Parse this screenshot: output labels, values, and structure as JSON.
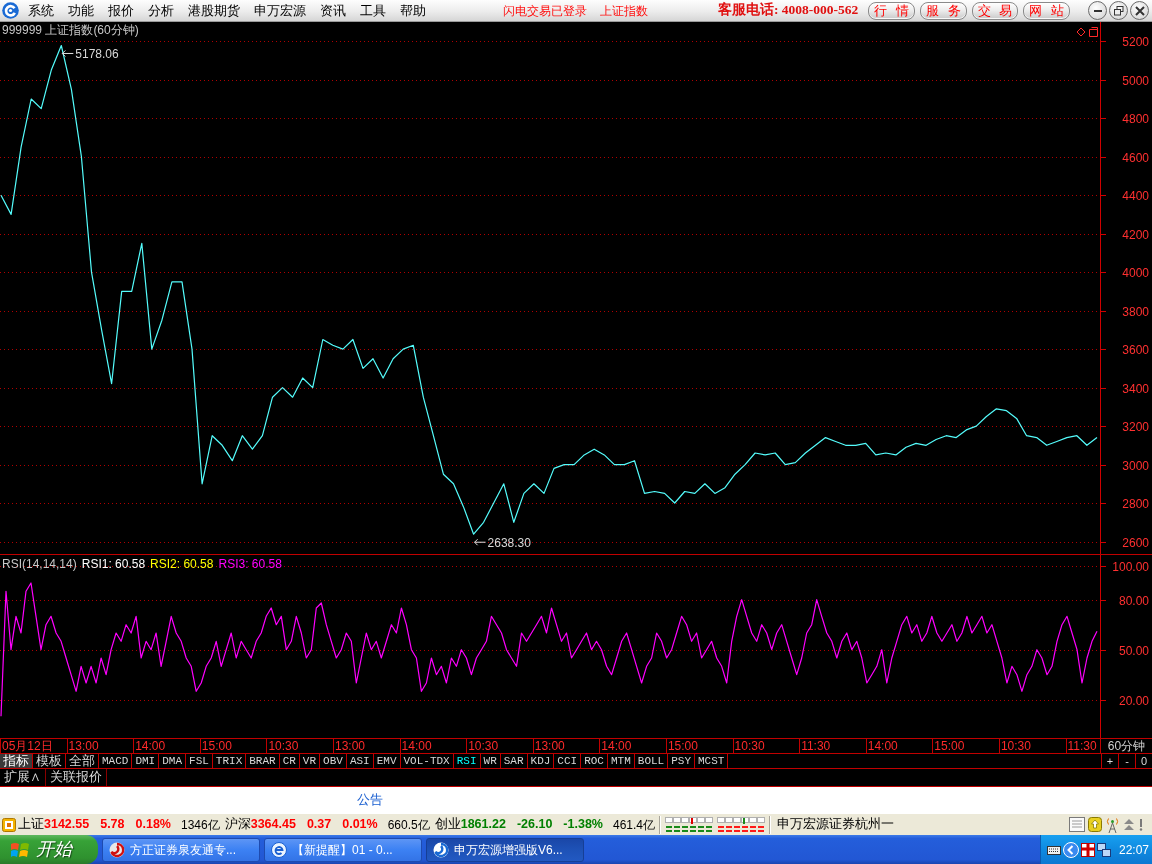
{
  "menu_bar": {
    "menus": [
      "系统",
      "功能",
      "报价",
      "分析",
      "港股期货",
      "申万宏源",
      "资讯",
      "工具",
      "帮助"
    ],
    "notices": [
      "闪电交易已登录",
      "上证指数"
    ],
    "hotline": "客服电话: 4008-000-562",
    "buttons": [
      "行 情",
      "服 务",
      "交 易",
      "网 站"
    ]
  },
  "price_panel": {
    "chart_data": {
      "type": "line",
      "title": "999999 上证指数(60分钟)",
      "grid": true,
      "ylim": [
        2530,
        5300
      ],
      "yticks": [
        2600,
        2800,
        3000,
        3200,
        3400,
        3600,
        3800,
        4000,
        4200,
        4400,
        4600,
        4800,
        5000,
        5200
      ],
      "series": [
        {
          "color": "#54fcfc",
          "values": [
            4400,
            4300,
            4650,
            4900,
            4850,
            5050,
            5178,
            4950,
            4600,
            4000,
            3700,
            3420,
            3900,
            3900,
            4150,
            3600,
            3750,
            3950,
            3950,
            3600,
            2900,
            3150,
            3100,
            3020,
            3150,
            3080,
            3150,
            3350,
            3400,
            3350,
            3450,
            3400,
            3650,
            3620,
            3600,
            3650,
            3500,
            3550,
            3450,
            3550,
            3600,
            3620,
            3350,
            3150,
            2950,
            2900,
            2780,
            2638,
            2700,
            2800,
            2900,
            2700,
            2850,
            2900,
            2850,
            2980,
            3000,
            3000,
            3050,
            3080,
            3050,
            3000,
            3000,
            3020,
            2850,
            2860,
            2850,
            2800,
            2860,
            2850,
            2900,
            2850,
            2880,
            2950,
            3000,
            3060,
            3050,
            3060,
            3000,
            3010,
            3060,
            3100,
            3140,
            3120,
            3100,
            3100,
            3110,
            3050,
            3060,
            3050,
            3090,
            3110,
            3100,
            3130,
            3150,
            3140,
            3180,
            3200,
            3250,
            3290,
            3280,
            3240,
            3150,
            3140,
            3100,
            3120,
            3140,
            3150,
            3100,
            3140
          ]
        }
      ],
      "annotations": [
        "5178.06",
        "2638.30"
      ]
    }
  },
  "rsi_panel": {
    "legend": [
      {
        "label": "RSI1: 60.58",
        "color": "#ffffff"
      },
      {
        "label": "RSI2: 60.58",
        "color": "#ffff00"
      },
      {
        "label": "RSI3: 60.58",
        "color": "#ff00ff"
      }
    ],
    "chart_data": {
      "type": "line",
      "title": "RSI(14,14,14)",
      "grid": true,
      "ylim": [
        -3,
        106.8
      ],
      "yticks": [
        {
          "value": 20,
          "label": "20.00"
        },
        {
          "value": 50,
          "label": "50.00"
        },
        {
          "value": 80,
          "label": "80.00"
        },
        {
          "value": 100,
          "label": "100.00"
        }
      ],
      "series": [
        {
          "color": "#ff00ff",
          "values": [
            10,
            85,
            50,
            70,
            60,
            85,
            90,
            70,
            50,
            65,
            70,
            60,
            55,
            45,
            35,
            25,
            40,
            30,
            40,
            30,
            45,
            35,
            50,
            60,
            55,
            65,
            60,
            70,
            45,
            55,
            50,
            60,
            40,
            55,
            70,
            60,
            55,
            45,
            40,
            25,
            30,
            40,
            45,
            55,
            40,
            50,
            60,
            45,
            55,
            50,
            45,
            55,
            60,
            70,
            75,
            65,
            70,
            50,
            55,
            70,
            60,
            45,
            50,
            75,
            78,
            65,
            55,
            45,
            50,
            60,
            55,
            30,
            45,
            60,
            50,
            55,
            45,
            55,
            65,
            60,
            75,
            65,
            50,
            45,
            25,
            30,
            45,
            35,
            40,
            30,
            45,
            40,
            50,
            45,
            35,
            45,
            50,
            55,
            70,
            65,
            60,
            50,
            45,
            40,
            60,
            55,
            60,
            65,
            70,
            60,
            75,
            65,
            55,
            60,
            45,
            50,
            55,
            60,
            50,
            55,
            50,
            40,
            35,
            45,
            55,
            60,
            50,
            40,
            30,
            40,
            45,
            60,
            55,
            45,
            50,
            60,
            70,
            65,
            55,
            60,
            45,
            50,
            55,
            45,
            40,
            30,
            55,
            70,
            80,
            70,
            60,
            55,
            65,
            60,
            50,
            60,
            65,
            55,
            45,
            35,
            45,
            60,
            65,
            80,
            70,
            60,
            55,
            45,
            55,
            60,
            50,
            55,
            45,
            30,
            35,
            40,
            50,
            30,
            45,
            55,
            65,
            70,
            60,
            65,
            55,
            60,
            70,
            60,
            55,
            60,
            65,
            55,
            60,
            70,
            60,
            65,
            70,
            60,
            65,
            55,
            45,
            30,
            40,
            35,
            25,
            35,
            40,
            50,
            45,
            35,
            40,
            55,
            65,
            70,
            60,
            50,
            30,
            45,
            55,
            61
          ]
        }
      ]
    }
  },
  "time_axis": {
    "labels": [
      "05月12日",
      "13:00",
      "14:00",
      "15:00",
      "10:30",
      "13:00",
      "14:00",
      "10:30",
      "13:00",
      "14:00",
      "15:00",
      "10:30",
      "11:30",
      "14:00",
      "15:00",
      "10:30",
      "11:30"
    ],
    "period": "60分钟"
  },
  "panel_tabs": [
    {
      "label": "指标",
      "selected": true
    },
    {
      "label": "模板",
      "selected": false
    },
    {
      "label": "全部",
      "selected": false
    }
  ],
  "indicator_tabs": [
    {
      "label": "MACD",
      "selected": false
    },
    {
      "label": "DMI",
      "selected": false
    },
    {
      "label": "DMA",
      "selected": false
    },
    {
      "label": "FSL",
      "selected": false
    },
    {
      "label": "TRIX",
      "selected": false
    },
    {
      "label": "BRAR",
      "selected": false
    },
    {
      "label": "CR",
      "selected": false
    },
    {
      "label": "VR",
      "selected": false
    },
    {
      "label": "OBV",
      "selected": false
    },
    {
      "label": "ASI",
      "selected": false
    },
    {
      "label": "EMV",
      "selected": false
    },
    {
      "label": "VOL-TDX",
      "selected": false
    },
    {
      "label": "RSI",
      "selected": true
    },
    {
      "label": "WR",
      "selected": false
    },
    {
      "label": "SAR",
      "selected": false
    },
    {
      "label": "KDJ",
      "selected": false
    },
    {
      "label": "CCI",
      "selected": false
    },
    {
      "label": "ROC",
      "selected": false
    },
    {
      "label": "MTM",
      "selected": false
    },
    {
      "label": "BOLL",
      "selected": false
    },
    {
      "label": "PSY",
      "selected": false
    },
    {
      "label": "MCST",
      "selected": false
    }
  ],
  "zoom_buttons": [
    "+",
    "-",
    "0"
  ],
  "extra_tabs": [
    "扩展∧",
    "关联报价"
  ],
  "bulletin": {
    "title": "公告"
  },
  "status_bar": {
    "indices": [
      {
        "name": "上证",
        "value": "3142.55",
        "change": "5.78",
        "percent": "0.18%",
        "turnover": "1346亿",
        "color": "#ff0000"
      },
      {
        "name": "沪深",
        "value": "3364.45",
        "change": "0.37",
        "percent": "0.01%",
        "turnover": "660.5亿",
        "color": "#ff0000"
      },
      {
        "name": "创业",
        "value": "1861.22",
        "change": "-26.10",
        "percent": "-1.38%",
        "turnover": "461.4亿",
        "color": "#008000"
      }
    ],
    "broker": "申万宏源证券杭州一"
  },
  "taskbar": {
    "start": "开始",
    "tasks": [
      {
        "label": "方正证券泉友通专...",
        "selected": false
      },
      {
        "label": "【新提醒】01 - 0...",
        "selected": false
      },
      {
        "label": "申万宏源增强版V6...",
        "selected": true
      }
    ],
    "clock": "22:07"
  }
}
